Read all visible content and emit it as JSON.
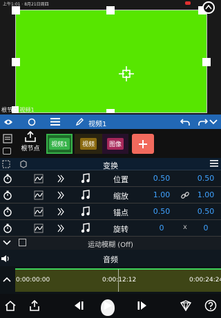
{
  "status_bar": {
    "left": "上午1:01  ⋅  8月21日周四",
    "right": ""
  },
  "preview": {
    "layer_name": "根节点  视频1"
  },
  "toolbar": {
    "layer_title": "视频1"
  },
  "layers": {
    "root_label": "根节点",
    "chips": [
      "视频1",
      "视频",
      "图像"
    ]
  },
  "transform": {
    "title": "变换",
    "rows": [
      {
        "name": "位置",
        "v1": "0.50",
        "mid": "",
        "v2": "0.50"
      },
      {
        "name": "缩放",
        "v1": "1.00",
        "mid": "link",
        "v2": "1.00"
      },
      {
        "name": "锚点",
        "v1": "0.50",
        "mid": "",
        "v2": "0.50"
      },
      {
        "name": "旋转",
        "v1": "0",
        "mid": "x",
        "v2": "0"
      }
    ],
    "motion_blur": "运动模糊 (Off)"
  },
  "audio": {
    "title": "音频",
    "timecodes": [
      "0:00:00:00",
      "0:00:12:12",
      "0:00:24:24"
    ]
  },
  "colors": {
    "green_screen": "#57e600",
    "toolbar_blue": "#2268b5",
    "value_blue": "#3fa2ff",
    "add_button": "#f26a5d"
  },
  "icons": {
    "toolbar": [
      "eye-icon",
      "circle-icon",
      "hamburger-icon",
      "pencil-icon",
      "undo-icon",
      "redo-icon",
      "collapse-icon"
    ],
    "bottom": [
      "home-icon",
      "share-icon",
      "step-back-icon",
      "play-icon",
      "step-forward-icon",
      "store-icon",
      "help-icon"
    ]
  }
}
